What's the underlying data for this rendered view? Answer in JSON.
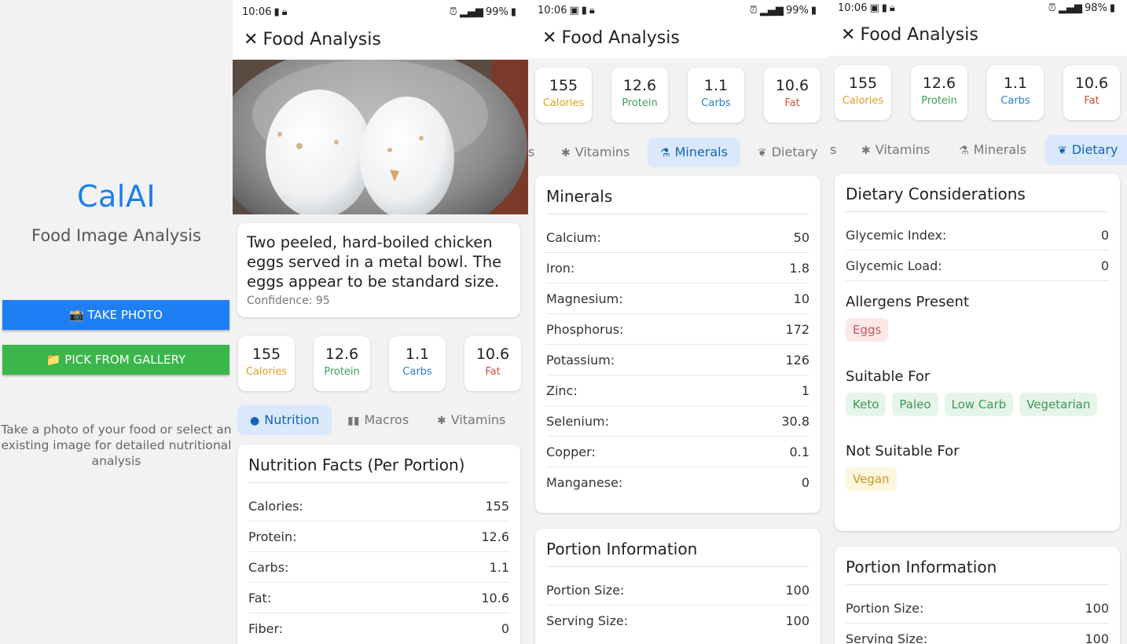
{
  "home": {
    "brand": "CalAI",
    "subtitle": "Food Image Analysis",
    "take_photo_label": "📸 TAKE PHOTO",
    "pick_gallery_label": "📁 PICK FROM GALLERY",
    "hint": "Take a photo of your food or select an existing image for detailed nutritional analysis"
  },
  "status": {
    "time": "10:06",
    "battery_p2": "99%",
    "battery_p3": "99%",
    "battery_p4": "98%"
  },
  "appbar": {
    "close_glyph": "✕",
    "title": "Food Analysis"
  },
  "analysis": {
    "description": "Two peeled, hard-boiled chicken eggs served in a metal bowl. The eggs appear to be standard size.",
    "confidence_label": "Confidence: 95"
  },
  "stats": [
    {
      "value": "155",
      "label": "Calories",
      "color": "#e0a020"
    },
    {
      "value": "12.6",
      "label": "Protein",
      "color": "#3aa35a"
    },
    {
      "value": "1.1",
      "label": "Carbs",
      "color": "#2a7fcf"
    },
    {
      "value": "10.6",
      "label": "Fat",
      "color": "#d0503a"
    }
  ],
  "tabs": {
    "nutrition": "Nutrition",
    "macros": "Macros",
    "vitamins": "Vitamins",
    "minerals": "Minerals",
    "dietary": "Dietary",
    "cut_left_p3": "s",
    "cut_left_p4": "s"
  },
  "nutrition": {
    "title": "Nutrition Facts (Per Portion)",
    "rows": [
      {
        "label": "Calories:",
        "value": "155"
      },
      {
        "label": "Protein:",
        "value": "12.6"
      },
      {
        "label": "Carbs:",
        "value": "1.1"
      },
      {
        "label": "Fat:",
        "value": "10.6"
      },
      {
        "label": "Fiber:",
        "value": "0"
      }
    ]
  },
  "minerals": {
    "title": "Minerals",
    "rows": [
      {
        "label": "Calcium:",
        "value": "50"
      },
      {
        "label": "Iron:",
        "value": "1.8"
      },
      {
        "label": "Magnesium:",
        "value": "10"
      },
      {
        "label": "Phosphorus:",
        "value": "172"
      },
      {
        "label": "Potassium:",
        "value": "126"
      },
      {
        "label": "Zinc:",
        "value": "1"
      },
      {
        "label": "Selenium:",
        "value": "30.8"
      },
      {
        "label": "Copper:",
        "value": "0.1"
      },
      {
        "label": "Manganese:",
        "value": "0"
      }
    ]
  },
  "portion": {
    "title": "Portion Information",
    "rows": [
      {
        "label": "Portion Size:",
        "value": "100"
      },
      {
        "label": "Serving Size:",
        "value": "100"
      }
    ]
  },
  "dietary": {
    "title": "Dietary Considerations",
    "rows": [
      {
        "label": "Glycemic Index:",
        "value": "0"
      },
      {
        "label": "Glycemic Load:",
        "value": "0"
      }
    ],
    "allergens_title": "Allergens Present",
    "allergens": [
      "Eggs"
    ],
    "suitable_title": "Suitable For",
    "suitable": [
      "Keto",
      "Paleo",
      "Low Carb",
      "Vegetarian"
    ],
    "not_suitable_title": "Not Suitable For",
    "not_suitable": [
      "Vegan"
    ]
  },
  "colors": {
    "brand_blue": "#1a7fe8",
    "take_photo_bg": "#1e7ff5",
    "gallery_bg": "#3ab64a",
    "active_tab_bg": "#d9e9fb",
    "active_tab_text": "#1663b8"
  },
  "icons": {
    "close": "close-icon",
    "nutrition": "apple-icon",
    "macros": "bar-chart-icon",
    "vitamins": "asterisk-icon",
    "minerals": "flask-icon",
    "dietary": "leaf-icon"
  }
}
